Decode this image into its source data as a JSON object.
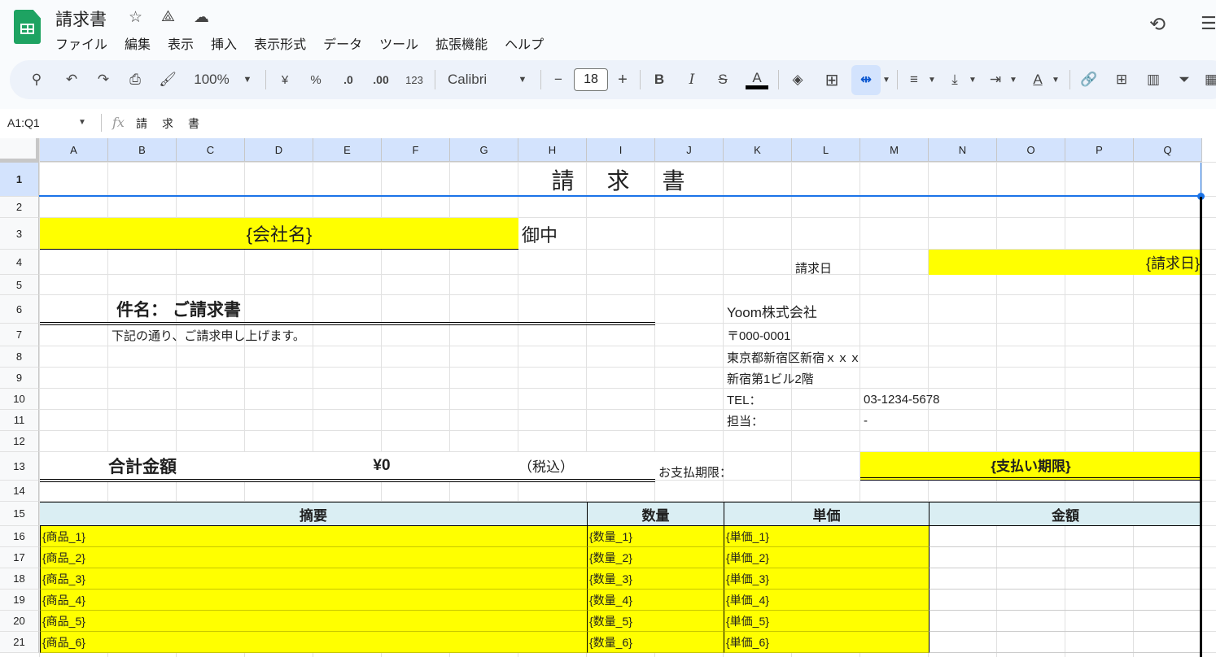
{
  "app": {
    "title": "請求書"
  },
  "menu": [
    "ファイル",
    "編集",
    "表示",
    "挿入",
    "表示形式",
    "データ",
    "ツール",
    "拡張機能",
    "ヘルプ"
  ],
  "toolbar": {
    "zoom": "100%",
    "currency": "¥",
    "percent": "%",
    "dec_decrease": ".0",
    "dec_increase": ".00",
    "format_123": "123",
    "font": "Calibri",
    "font_size": "18",
    "bold": "B",
    "italic": "I",
    "text_color": "A"
  },
  "formula_bar": {
    "range": "A1:Q1",
    "fx": "fx",
    "value": "請　求　書"
  },
  "columns": [
    "A",
    "B",
    "C",
    "D",
    "E",
    "F",
    "G",
    "H",
    "I",
    "J",
    "K",
    "L",
    "M",
    "N",
    "O",
    "P",
    "Q"
  ],
  "rows": [
    "1",
    "2",
    "3",
    "4",
    "5",
    "6",
    "7",
    "8",
    "9",
    "10",
    "11",
    "12",
    "13",
    "14",
    "15",
    "16",
    "17",
    "18",
    "19",
    "20",
    "21"
  ],
  "sheet": {
    "title": "請　求　書",
    "company_placeholder": "{会社名}",
    "onchu": "御中",
    "invoice_date_label": "請求日",
    "invoice_date_placeholder": "{請求日}",
    "subject": "件名：  ご請求書",
    "intro": "下記の通り、ご請求申し上げます。",
    "issuer": {
      "name": "Yoom株式会社",
      "postal": "〒000-0001",
      "address1": "東京都新宿区新宿ｘｘｘ",
      "address2": "新宿第1ビル2階",
      "tel_label": "TEL：",
      "tel": "03-1234-5678",
      "contact_label": "担当：",
      "contact": "-"
    },
    "total_label": "合計金額",
    "total": "¥0",
    "tax_note": "（税込）",
    "due_label": "お支払期限：",
    "due_placeholder": "{支払い期限}",
    "table_headers": [
      "摘要",
      "数量",
      "単価",
      "金額"
    ],
    "items": [
      {
        "name": "{商品_1}",
        "qty": "{数量_1}",
        "price": "{単価_1}"
      },
      {
        "name": "{商品_2}",
        "qty": "{数量_2}",
        "price": "{単価_2}"
      },
      {
        "name": "{商品_3}",
        "qty": "{数量_3}",
        "price": "{単価_3}"
      },
      {
        "name": "{商品_4}",
        "qty": "{数量_4}",
        "price": "{単価_4}"
      },
      {
        "name": "{商品_5}",
        "qty": "{数量_5}",
        "price": "{単価_5}"
      },
      {
        "name": "{商品_6}",
        "qty": "{数量_6}",
        "price": "{単価_6}"
      }
    ]
  }
}
